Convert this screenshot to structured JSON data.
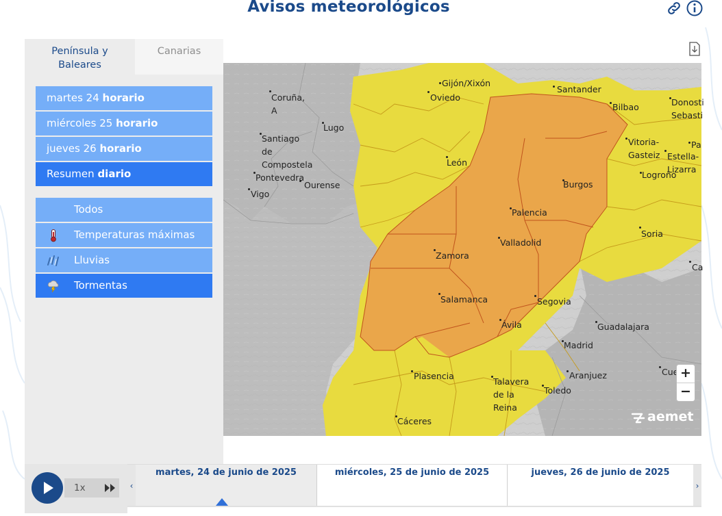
{
  "header": {
    "title": "Avisos meteorológicos",
    "link_icon": "link-icon",
    "info_icon": "info-icon"
  },
  "tabs": [
    {
      "label": "Península y Baleares",
      "active": true
    },
    {
      "label": "Canarias",
      "active": false
    }
  ],
  "days": [
    {
      "day": "martes 24",
      "mode": "horario",
      "active": false
    },
    {
      "day": "miércoles 25",
      "mode": "horario",
      "active": false
    },
    {
      "day": "jueves 26",
      "mode": "horario",
      "active": false
    },
    {
      "day": "Resumen",
      "mode": "diario",
      "active": true
    }
  ],
  "types": [
    {
      "label": "Todos",
      "icon": "",
      "active": false
    },
    {
      "label": "Temperaturas máximas",
      "icon": "thermometer-icon",
      "active": false
    },
    {
      "label": "Lluvias",
      "icon": "rain-icon",
      "active": false
    },
    {
      "label": "Tormentas",
      "icon": "storm-icon",
      "active": true
    }
  ],
  "map": {
    "colors": {
      "background": "#c9c9c9",
      "outside": "#bdbdbd",
      "land_grey": "#b3b3b3",
      "yellow": "#e8db3f",
      "orange": "#eaa64a",
      "border_yellow": "#c8a11c",
      "border_orange": "#c0531c"
    },
    "cities": [
      "Coruña,\nA",
      "Gijón/Xixón",
      "Santander",
      "Bilbao",
      "Donosti\nSebasti",
      "Oviedo",
      "Lugo",
      "Santiago\nde\nCompostela",
      "León",
      "Vitoria-\nGasteiz",
      "Estella-\nLizarra",
      "Pa",
      "Logroño",
      "Pontevedra",
      "Ourense",
      "Vigo",
      "Burgos",
      "Palencia",
      "Soria",
      "Valladolid",
      "Zamora",
      "Ca",
      "Salamanca",
      "Segovia",
      "Ávila",
      "Guadalajara",
      "Madrid",
      "Aranjuez",
      "Plasencia",
      "Talavera\nde la\nReina",
      "Toledo",
      "Cue",
      "Cáceres"
    ],
    "zoom_in": "+",
    "zoom_out": "−",
    "logo": "aemet"
  },
  "player": {
    "speed": "1x",
    "play_icon": "play-icon",
    "ff_icon": "fast-forward-icon"
  },
  "timeline": {
    "days": [
      {
        "label": "martes, 24 de junio de 2025",
        "active": true
      },
      {
        "label": "miércoles, 25 de junio de 2025",
        "active": false
      },
      {
        "label": "jueves, 26 de junio de 2025",
        "active": false
      }
    ],
    "prev": "‹",
    "next": "›"
  }
}
